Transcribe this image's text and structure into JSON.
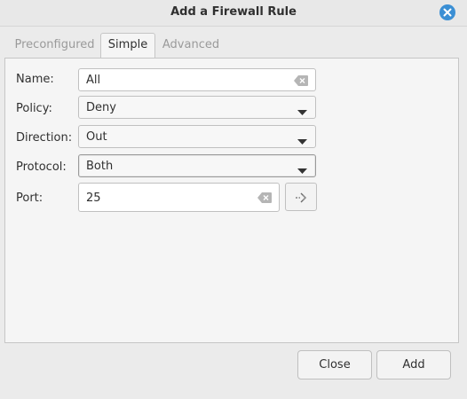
{
  "window": {
    "title": "Add a Firewall Rule",
    "close_icon": "close-icon"
  },
  "tabs": [
    {
      "label": "Preconfigured",
      "active": false
    },
    {
      "label": "Simple",
      "active": true
    },
    {
      "label": "Advanced",
      "active": false
    }
  ],
  "form": {
    "name": {
      "label": "Name:",
      "value": "All"
    },
    "policy": {
      "label": "Policy:",
      "value": "Deny"
    },
    "direction": {
      "label": "Direction:",
      "value": "Out"
    },
    "protocol": {
      "label": "Protocol:",
      "value": "Both"
    },
    "port": {
      "label": "Port:",
      "value": "25"
    }
  },
  "buttons": {
    "close_label": "Close",
    "add_label": "Add"
  },
  "colors": {
    "accent": "#3b8fd4",
    "background": "#ebebeb"
  }
}
